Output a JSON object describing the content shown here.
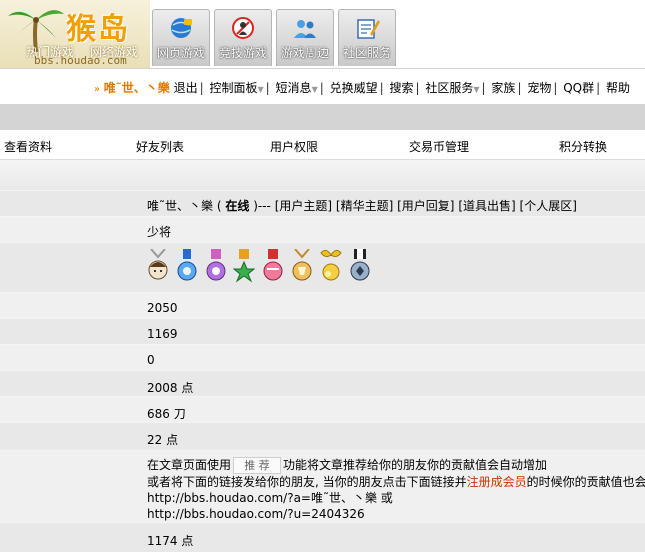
{
  "header": {
    "logo_text": "猴岛",
    "logo_url": "bbs.houdao.com",
    "hot_tabs": [
      "热门游戏",
      "网络游戏"
    ],
    "tabs": [
      {
        "label": "网页游戏",
        "icon": "web-game-icon"
      },
      {
        "label": "竞技游戏",
        "icon": "compete-game-icon"
      },
      {
        "label": "游戏周边",
        "icon": "game-peripheral-icon"
      },
      {
        "label": "社区服务",
        "icon": "community-service-icon"
      }
    ]
  },
  "userbar": {
    "arrow": "»",
    "username": "唯˜世、丶樂",
    "items": [
      "退出",
      "控制面板",
      "短消息",
      "兑换威望",
      "搜索",
      "社区服务",
      "家族",
      "宠物",
      "QQ群",
      "帮助"
    ]
  },
  "profile_tabs": [
    "查看资料",
    "好友列表",
    "用户权限",
    "交易币管理",
    "积分转换"
  ],
  "profile": {
    "name": "唯˜世、丶樂",
    "status_open": "(",
    "status": "在线",
    "status_close": ")---",
    "links": [
      "[用户主题]",
      "[精华主题]",
      "[用户回复]",
      "[道具出售]",
      "[个人展区]"
    ],
    "rank": "少将",
    "medals": [
      "girl-medal-icon",
      "blue-flower-medal-icon",
      "purple-ring-medal-icon",
      "green-star-medal-icon",
      "red-ribbon-medal-icon",
      "trophy-medal-icon",
      "gold-bow-medal-icon",
      "black-shield-medal-icon"
    ],
    "stat1": "2050",
    "stat2": "1169",
    "stat3": "0",
    "stat4": "2008 点",
    "stat5": "686 刀",
    "stat6": "22 点",
    "recommend": {
      "prefix": "在文章页面使用",
      "button": "推 荐",
      "suffix": "功能将文章推荐给你的朋友你的贡献值会自动增加",
      "line2_a": "或者将下面的链接发给你的朋友, 当你的朋友点击下面链接并",
      "line2_link": "注册成会员",
      "line2_b": "的时候你的贡献值也会",
      "url1": "http://bbs.houdao.com/?a=唯˜世、丶樂 或",
      "url2": "http://bbs.houdao.com/?u=2404326"
    },
    "stat7": "1174 点"
  },
  "colors": {
    "accent": "#e07a00",
    "link_red": "#cc3300",
    "grey_row": "#e8e8e8"
  }
}
